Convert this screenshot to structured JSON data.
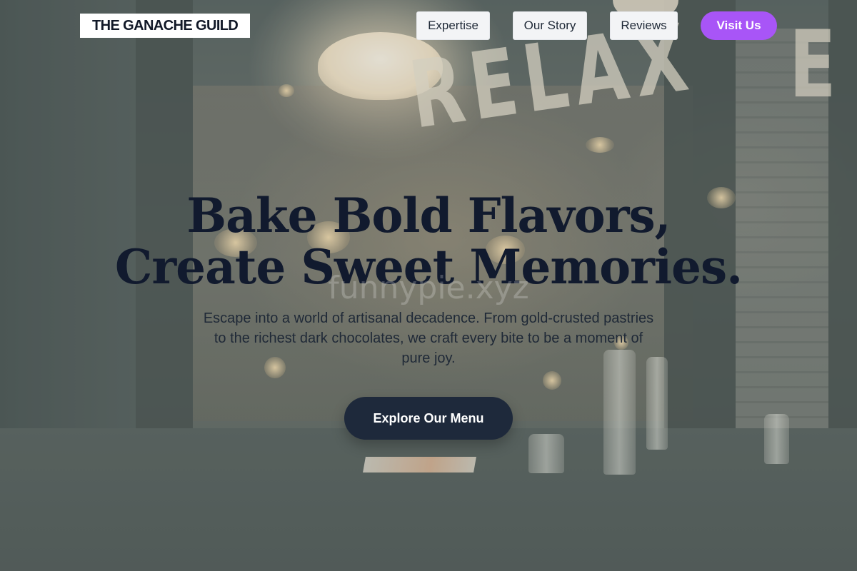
{
  "header": {
    "logo": "THE GANACHE GUILD",
    "nav": [
      {
        "label": "Expertise"
      },
      {
        "label": "Our Story"
      },
      {
        "label": "Reviews"
      }
    ],
    "visit_label": "Visit Us"
  },
  "background": {
    "sign_text": "RELAX",
    "sign_text_right": "E"
  },
  "hero": {
    "title_line1": "Bake Bold Flavors,",
    "title_line2": "Create Sweet Memories.",
    "subtitle": "Escape into a world of artisanal decadence. From gold-crusted pastries to the richest dark chocolates, we craft every bite to be a moment of pure joy.",
    "cta_label": "Explore Our Menu",
    "watermark": "funnypie.xyz"
  },
  "colors": {
    "accent": "#a855f7",
    "cta_background": "#1e293b",
    "title_text": "#111a2e",
    "nav_button_background": "#f3f4f6"
  }
}
